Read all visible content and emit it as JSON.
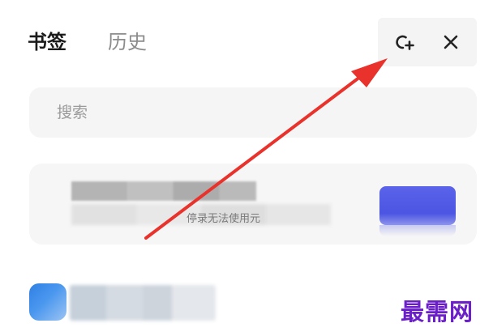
{
  "header": {
    "tabs": [
      {
        "label": "书签",
        "active": true
      },
      {
        "label": "历史",
        "active": false
      }
    ],
    "actions": {
      "add_icon": "add-bookmark-icon",
      "close_icon": "close-icon"
    }
  },
  "search": {
    "placeholder": "搜索",
    "value": ""
  },
  "bookmarks": [
    {
      "subtitle": "停录无法使用元"
    }
  ],
  "watermark": "最需网",
  "colors": {
    "accent_arrow": "#e8322b",
    "thumbnail_blue": "#4b55e2",
    "watermark": "#6a1fc9"
  }
}
